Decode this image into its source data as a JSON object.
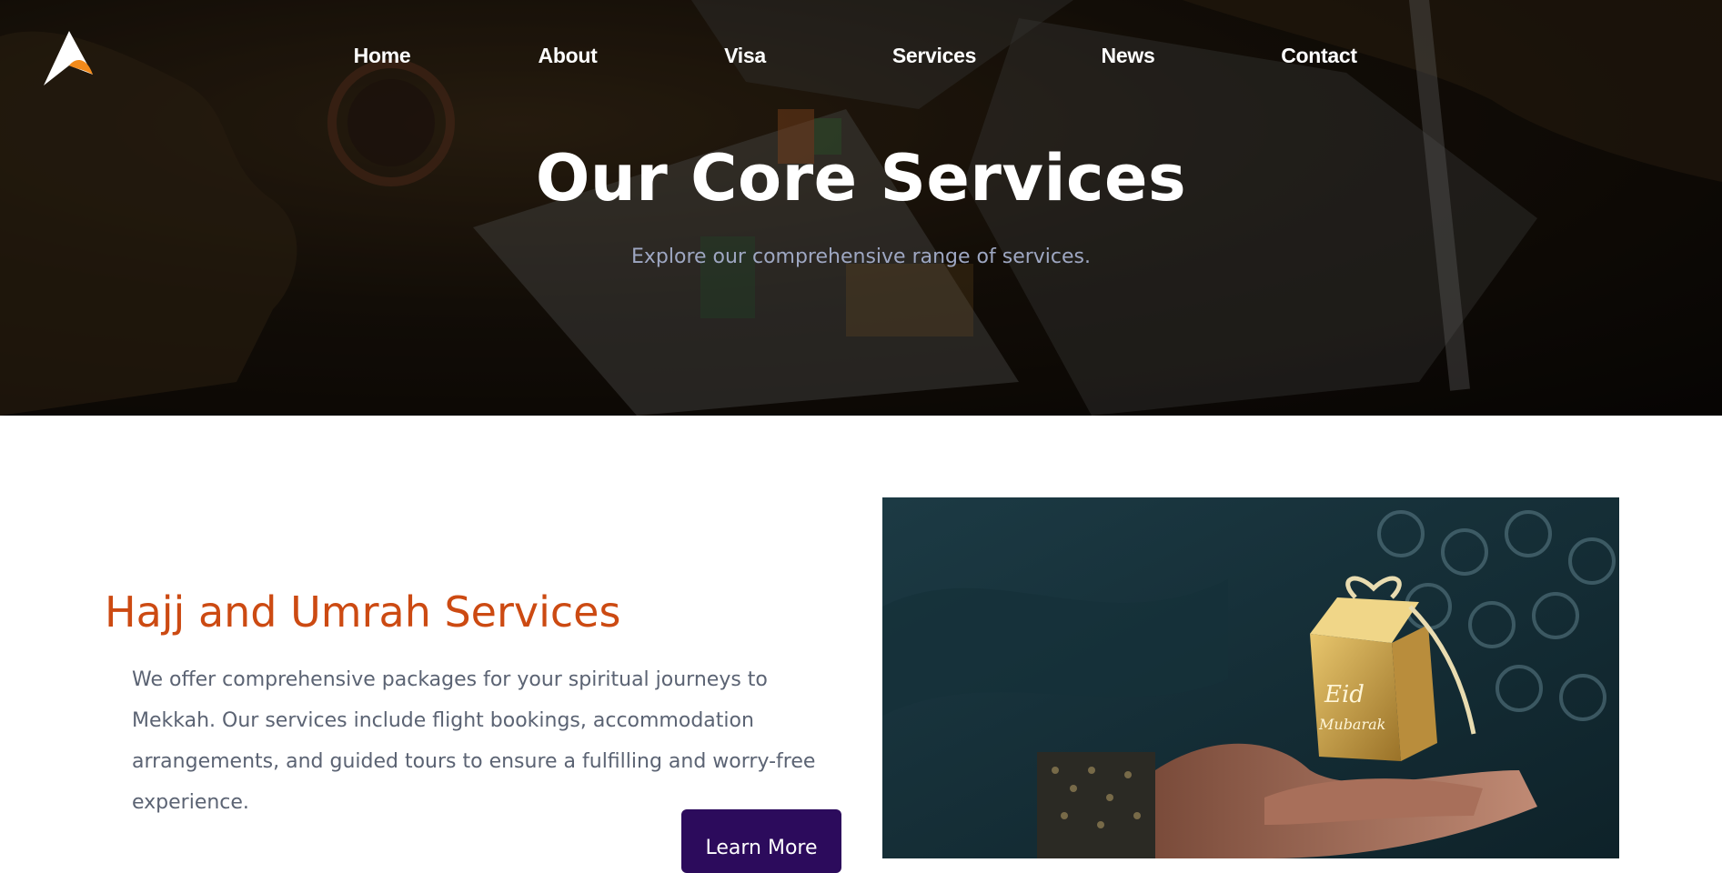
{
  "nav": {
    "items": [
      {
        "label": "Home"
      },
      {
        "label": "About"
      },
      {
        "label": "Visa"
      },
      {
        "label": "Services"
      },
      {
        "label": "News"
      },
      {
        "label": "Contact"
      }
    ]
  },
  "logo": {
    "icon": "logo-icon",
    "colors": {
      "primary": "#ffffff",
      "accent": "#f28a1a"
    }
  },
  "hero": {
    "title": "Our Core Services",
    "subtitle": "Explore our comprehensive range of services."
  },
  "service": {
    "title": "Hajj and Umrah Services",
    "description": "We offer comprehensive packages for your spiritual journeys to Mekkah. Our services include flight bookings, accommodation arrangements, and guided tours to ensure a fulfilling and worry-free experience.",
    "button_label": "Learn More",
    "image_box_text_1": "Eid",
    "image_box_text_2": "Mubarak"
  },
  "colors": {
    "title_accent": "#cc4a12",
    "button_bg": "#2c0b5c",
    "hero_subtitle": "#9ea7c2",
    "body_text": "#5b6373"
  }
}
